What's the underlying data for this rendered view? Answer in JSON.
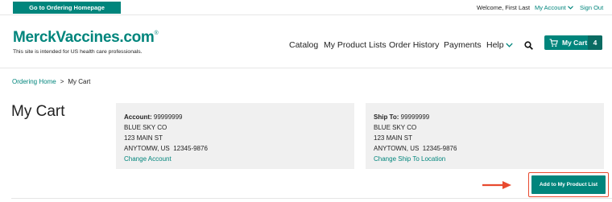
{
  "utility": {
    "home_button": "Go to Ordering Homepage",
    "welcome": "Welcome, First Last",
    "my_account": "My Account",
    "sign_out": "Sign Out"
  },
  "header": {
    "logo_text": "MerckVaccines.com",
    "logo_mark": "®",
    "tagline": "This site is intended for US health care professionals.",
    "nav": {
      "catalog": "Catalog",
      "product_lists": "My Product Lists",
      "order_history": "Order History",
      "payments": "Payments",
      "help": "Help"
    },
    "cart": {
      "label": "My Cart",
      "count": "4"
    }
  },
  "breadcrumb": {
    "home": "Ordering Home",
    "separator": ">",
    "current": "My Cart"
  },
  "page_title": "My Cart",
  "account_card": {
    "heading_label": "Account:",
    "heading_value": "99999999",
    "name": "BLUE SKY CO",
    "street": "123 MAIN ST",
    "city_line": "ANYTOMW, US  12345-9876",
    "link": "Change Account"
  },
  "ship_card": {
    "heading_label": "Ship To:",
    "heading_value": "99999999",
    "name": "BLUE SKY CO",
    "street": "123 MAIN ST",
    "city_line": "ANYTOWN, US  12345-9876",
    "link": "Change Ship To Location"
  },
  "actions": {
    "add_to_list": "Add to My Product List"
  },
  "colors": {
    "brand": "#00857c",
    "highlight": "#e84a2f",
    "card_bg": "#f0f0f0"
  },
  "icons": [
    "chevron-down-icon",
    "search-icon",
    "cart-icon",
    "arrow-right-icon"
  ]
}
